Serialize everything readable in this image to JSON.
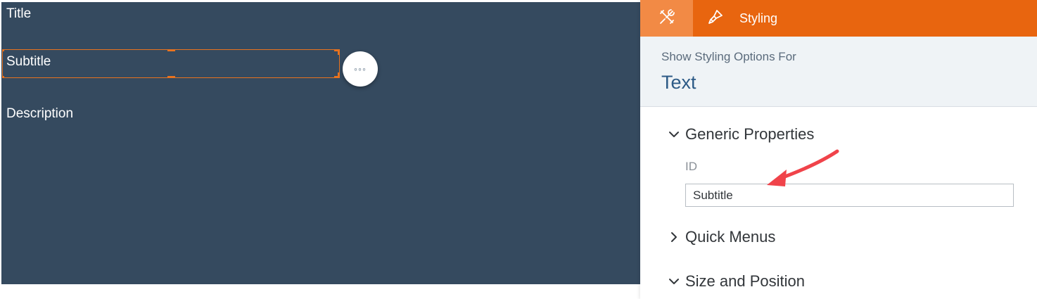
{
  "canvas": {
    "widgets": {
      "title": "Title",
      "subtitle": "Subtitle",
      "description": "Description"
    },
    "more_button_glyph": "◦◦◦"
  },
  "panel": {
    "tabs": {
      "builder_icon": "tools-icon",
      "styling_icon": "brush-icon",
      "styling_label": "Styling"
    },
    "header": {
      "show_for": "Show Styling Options For",
      "target_type": "Text"
    },
    "sections": {
      "generic": "Generic Properties",
      "quick_menus": "Quick Menus",
      "size_position": "Size and Position"
    },
    "id_label": "ID",
    "id_value": "Subtitle"
  },
  "colors": {
    "canvas_bg": "#354a5f",
    "accent": "#e8650f",
    "accent_light": "#f28a45",
    "selection": "#e8731f",
    "annotation_arrow": "#f0434a"
  }
}
